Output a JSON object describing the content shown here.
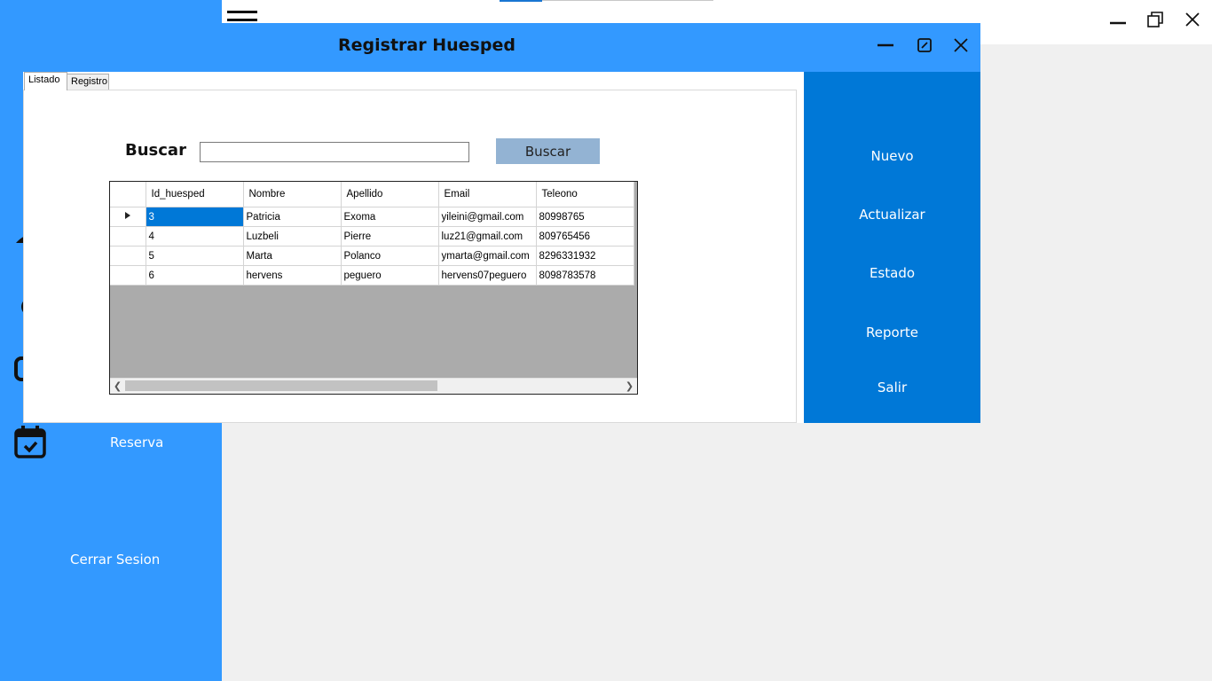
{
  "sidebar": {
    "items": [
      {
        "label": "Reserva",
        "icon": "calendar-check-icon"
      },
      {
        "label": "Cerrar Sesion"
      }
    ]
  },
  "dialog": {
    "title": "Registrar Huesped",
    "tabs": [
      {
        "label": "Listado",
        "active": true
      },
      {
        "label": "Registro",
        "active": false
      }
    ],
    "search": {
      "label": "Buscar",
      "value": "",
      "placeholder": "",
      "button_label": "Buscar"
    },
    "grid": {
      "columns": [
        "Id_huesped",
        "Nombre",
        "Apellido",
        "Email",
        "Teleono"
      ],
      "rows": [
        [
          "3",
          "Patricia",
          "Exoma",
          "yileini@gmail.com",
          "80998765"
        ],
        [
          "4",
          "Luzbeli",
          "Pierre",
          "luz21@gmail.com",
          "809765456"
        ],
        [
          "5",
          "Marta",
          "Polanco",
          "ymarta@gmail.com",
          "8296331932"
        ],
        [
          "6",
          "hervens",
          "peguero",
          "hervens07peguero",
          "8098783578"
        ]
      ],
      "selected_row": 0
    },
    "actions": [
      "Nuevo",
      "Actualizar",
      "Estado",
      "Reporte",
      "Salir"
    ]
  },
  "colors": {
    "sidebar": "#3399ff",
    "action_panel": "#0078d7",
    "selection": "#0078d7",
    "search_button": "#93b3d3"
  }
}
